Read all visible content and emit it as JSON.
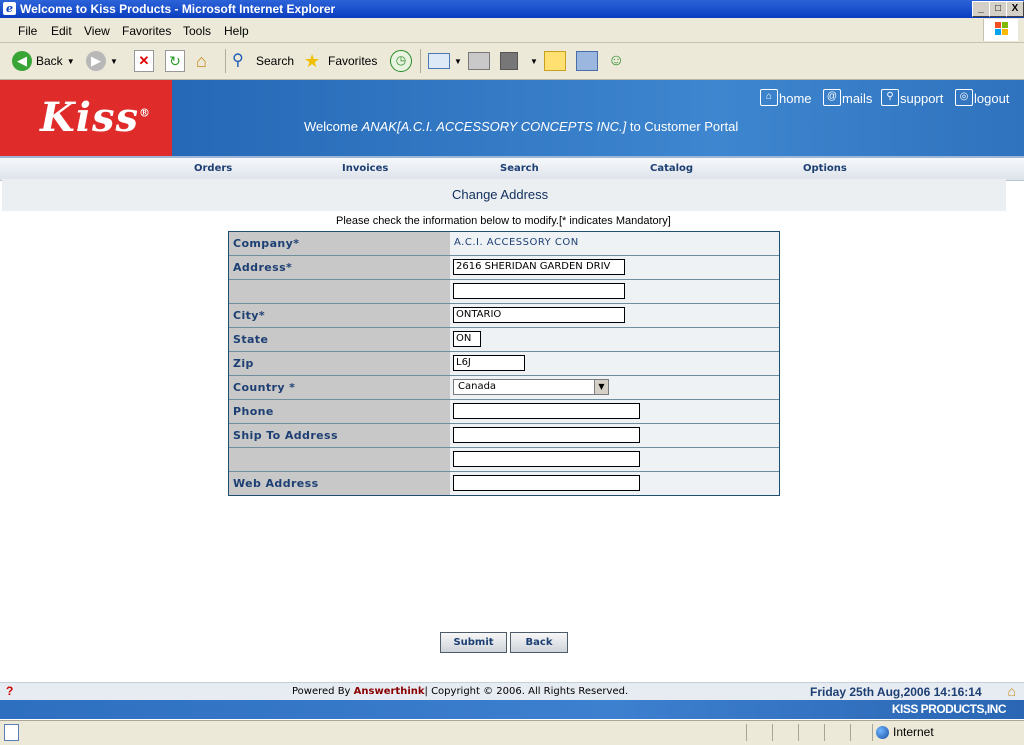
{
  "window": {
    "title": "Welcome to Kiss Products - Microsoft Internet Explorer",
    "min": "_",
    "max": "□",
    "close": "X"
  },
  "menubar": {
    "items": [
      "File",
      "Edit",
      "View",
      "Favorites",
      "Tools",
      "Help"
    ]
  },
  "toolbar": {
    "back": "Back",
    "search": "Search",
    "favorites": "Favorites"
  },
  "banner": {
    "logo": "Kiss",
    "logo_mark": "®",
    "welcome_prefix": "Welcome",
    "company": "ANAK[A.C.I. ACCESSORY CONCEPTS INC.]",
    "welcome_suffix": "to Customer Portal",
    "links": {
      "home": "home",
      "mails": "mails",
      "support": "support",
      "logout": "logout"
    }
  },
  "nav": {
    "orders": "Orders",
    "invoices": "Invoices",
    "search": "Search",
    "catalog": "Catalog",
    "options": "Options"
  },
  "page": {
    "heading": "Change Address",
    "instructions": "Please check the information below to modify.[* indicates Mandatory]"
  },
  "form": {
    "company_label": "Company*",
    "company_value": "A.C.I. ACCESSORY CON",
    "address_label": "Address*",
    "address1_value": "2616 SHERIDAN GARDEN DRIV",
    "address2_value": "",
    "city_label": "City*",
    "city_value": "ONTARIO",
    "state_label": "State",
    "state_value": "ON",
    "zip_label": "Zip",
    "zip_value": "L6J",
    "country_label": "Country *",
    "country_value": "Canada",
    "phone_label": "Phone",
    "phone_value": "",
    "ship_label": "Ship To Address",
    "ship1_value": "",
    "ship2_value": "",
    "web_label": "Web Address",
    "web_value": ""
  },
  "buttons": {
    "submit": "Submit",
    "back": "Back"
  },
  "footer": {
    "help": "?",
    "powered_prefix": "Powered By",
    "powered_brand": "Answerthink",
    "copyright": "| Copyright © 2006. All Rights Reserved.",
    "datetime": "Friday 25th Aug,2006 14:16:14",
    "brand": "KISS PRODUCTS,INC"
  },
  "statusbar": {
    "zone": "Internet"
  },
  "colors": {
    "banner_blue": "#2f72bd",
    "logo_red": "#e02b2b",
    "nav_text": "#1d3f73"
  }
}
